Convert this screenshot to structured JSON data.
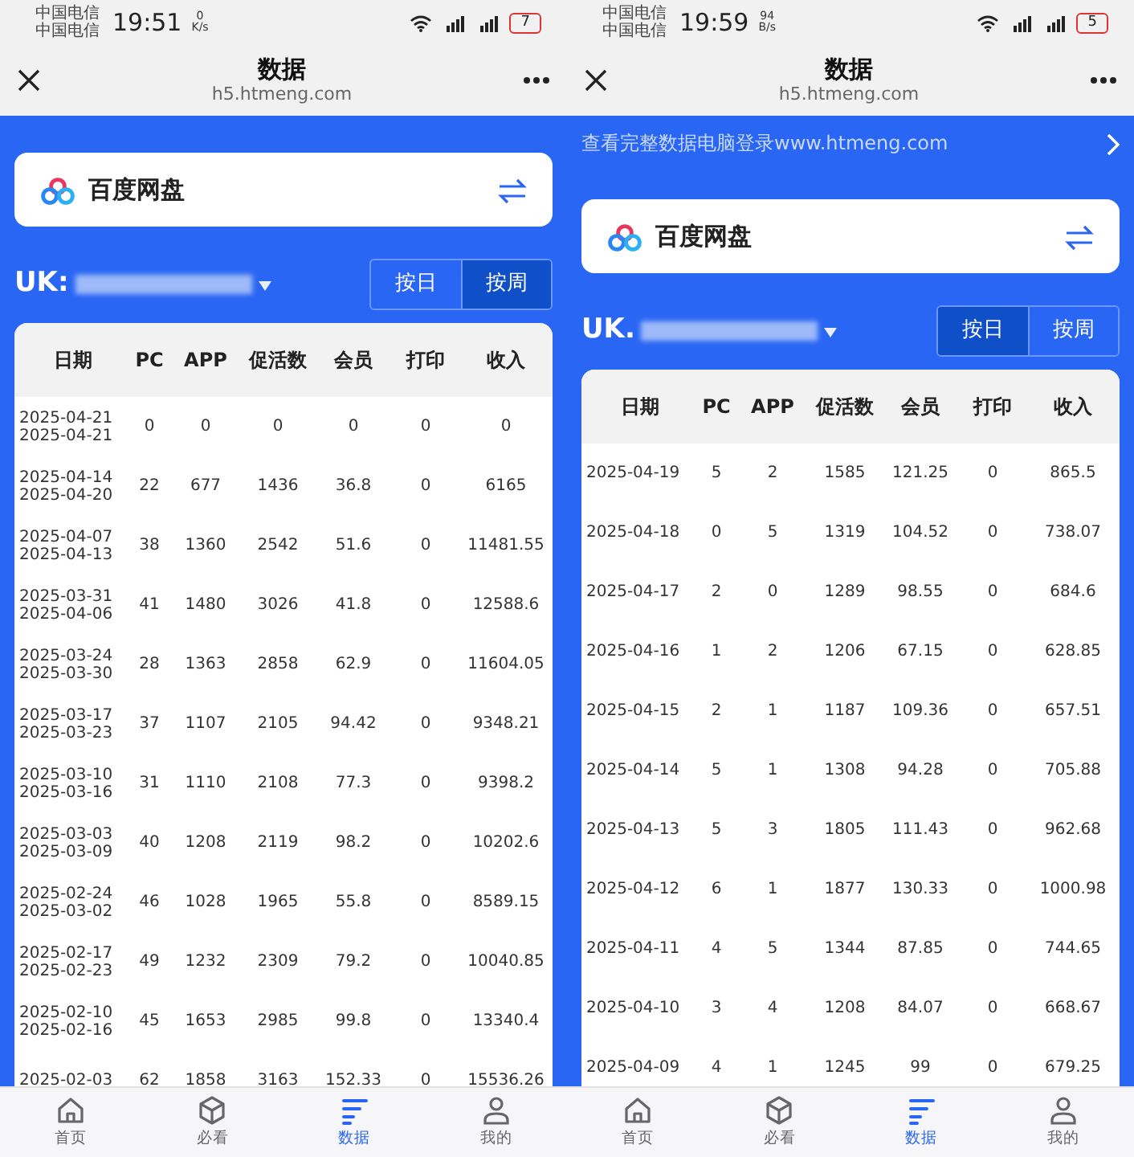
{
  "phones": [
    {
      "status_bar": {
        "carriers": [
          "中国电信",
          "中国电信"
        ],
        "time": "19:51",
        "speed_value": "0",
        "speed_unit": "K/s",
        "battery": "7"
      },
      "header": {
        "title": "数据",
        "url": "h5.htmeng.com"
      },
      "account_card": {
        "name": "百度网盘"
      },
      "uk_label": "UK:",
      "toggle": [
        {
          "label": "按日",
          "selected": false
        },
        {
          "label": "按周",
          "selected": true
        }
      ],
      "table": {
        "columns": [
          "日期",
          "PC",
          "APP",
          "促活数",
          "会员",
          "打印",
          "收入"
        ],
        "rows": [
          {
            "date": [
              "2025-04-21",
              "2025-04-21"
            ],
            "values": [
              "0",
              "0",
              "0",
              "0",
              "0",
              "0"
            ]
          },
          {
            "date": [
              "2025-04-14",
              "2025-04-20"
            ],
            "values": [
              "22",
              "677",
              "1436",
              "36.8",
              "0",
              "6165"
            ]
          },
          {
            "date": [
              "2025-04-07",
              "2025-04-13"
            ],
            "values": [
              "38",
              "1360",
              "2542",
              "51.6",
              "0",
              "11481.55"
            ]
          },
          {
            "date": [
              "2025-03-31",
              "2025-04-06"
            ],
            "values": [
              "41",
              "1480",
              "3026",
              "41.8",
              "0",
              "12588.6"
            ]
          },
          {
            "date": [
              "2025-03-24",
              "2025-03-30"
            ],
            "values": [
              "28",
              "1363",
              "2858",
              "62.9",
              "0",
              "11604.05"
            ]
          },
          {
            "date": [
              "2025-03-17",
              "2025-03-23"
            ],
            "values": [
              "37",
              "1107",
              "2105",
              "94.42",
              "0",
              "9348.21"
            ]
          },
          {
            "date": [
              "2025-03-10",
              "2025-03-16"
            ],
            "values": [
              "31",
              "1110",
              "2108",
              "77.3",
              "0",
              "9398.2"
            ]
          },
          {
            "date": [
              "2025-03-03",
              "2025-03-09"
            ],
            "values": [
              "40",
              "1208",
              "2119",
              "98.2",
              "0",
              "10202.6"
            ]
          },
          {
            "date": [
              "2025-02-24",
              "2025-03-02"
            ],
            "values": [
              "46",
              "1028",
              "1965",
              "55.8",
              "0",
              "8589.15"
            ]
          },
          {
            "date": [
              "2025-02-17",
              "2025-02-23"
            ],
            "values": [
              "49",
              "1232",
              "2309",
              "79.2",
              "0",
              "10040.85"
            ]
          },
          {
            "date": [
              "2025-02-10",
              "2025-02-16"
            ],
            "values": [
              "45",
              "1653",
              "2985",
              "99.8",
              "0",
              "13340.4"
            ]
          },
          {
            "date": [
              "2025-02-03"
            ],
            "values": [
              "62",
              "1858",
              "3163",
              "152.33",
              "0",
              "15536.26"
            ]
          }
        ]
      },
      "tab_bar": [
        {
          "label": "首页",
          "kind": "home",
          "selected": false
        },
        {
          "label": "必看",
          "kind": "cube",
          "selected": false
        },
        {
          "label": "数据",
          "kind": "data",
          "selected": true
        },
        {
          "label": "我的",
          "kind": "person",
          "selected": false
        }
      ]
    },
    {
      "status_bar": {
        "carriers": [
          "中国电信",
          "中国电信"
        ],
        "time": "19:59",
        "speed_value": "94",
        "speed_unit": "B/s",
        "battery": "5"
      },
      "header": {
        "title": "数据",
        "url": "h5.htmeng.com"
      },
      "banner": {
        "text": "查看完整数据电脑登录www.htmeng.com"
      },
      "account_card": {
        "name": "百度网盘"
      },
      "uk_label": "UK.",
      "toggle": [
        {
          "label": "按日",
          "selected": true
        },
        {
          "label": "按周",
          "selected": false
        }
      ],
      "table": {
        "columns": [
          "日期",
          "PC",
          "APP",
          "促活数",
          "会员",
          "打印",
          "收入"
        ],
        "rows": [
          {
            "date": [
              "2025-04-19"
            ],
            "values": [
              "5",
              "2",
              "1585",
              "121.25",
              "0",
              "865.5"
            ]
          },
          {
            "date": [
              "2025-04-18"
            ],
            "values": [
              "0",
              "5",
              "1319",
              "104.52",
              "0",
              "738.07"
            ]
          },
          {
            "date": [
              "2025-04-17"
            ],
            "values": [
              "2",
              "0",
              "1289",
              "98.55",
              "0",
              "684.6"
            ]
          },
          {
            "date": [
              "2025-04-16"
            ],
            "values": [
              "1",
              "2",
              "1206",
              "67.15",
              "0",
              "628.85"
            ]
          },
          {
            "date": [
              "2025-04-15"
            ],
            "values": [
              "2",
              "1",
              "1187",
              "109.36",
              "0",
              "657.51"
            ]
          },
          {
            "date": [
              "2025-04-14"
            ],
            "values": [
              "5",
              "1",
              "1308",
              "94.28",
              "0",
              "705.88"
            ]
          },
          {
            "date": [
              "2025-04-13"
            ],
            "values": [
              "5",
              "3",
              "1805",
              "111.43",
              "0",
              "962.68"
            ]
          },
          {
            "date": [
              "2025-04-12"
            ],
            "values": [
              "6",
              "1",
              "1877",
              "130.33",
              "0",
              "1000.98"
            ]
          },
          {
            "date": [
              "2025-04-11"
            ],
            "values": [
              "4",
              "5",
              "1344",
              "87.85",
              "0",
              "744.65"
            ]
          },
          {
            "date": [
              "2025-04-10"
            ],
            "values": [
              "3",
              "4",
              "1208",
              "84.07",
              "0",
              "668.67"
            ]
          },
          {
            "date": [
              "2025-04-09"
            ],
            "values": [
              "4",
              "1",
              "1245",
              "99",
              "0",
              "679.25"
            ]
          }
        ]
      },
      "tab_bar": [
        {
          "label": "首页",
          "kind": "home",
          "selected": false
        },
        {
          "label": "必看",
          "kind": "cube",
          "selected": false
        },
        {
          "label": "数据",
          "kind": "data",
          "selected": true
        },
        {
          "label": "我的",
          "kind": "person",
          "selected": false
        }
      ]
    }
  ]
}
